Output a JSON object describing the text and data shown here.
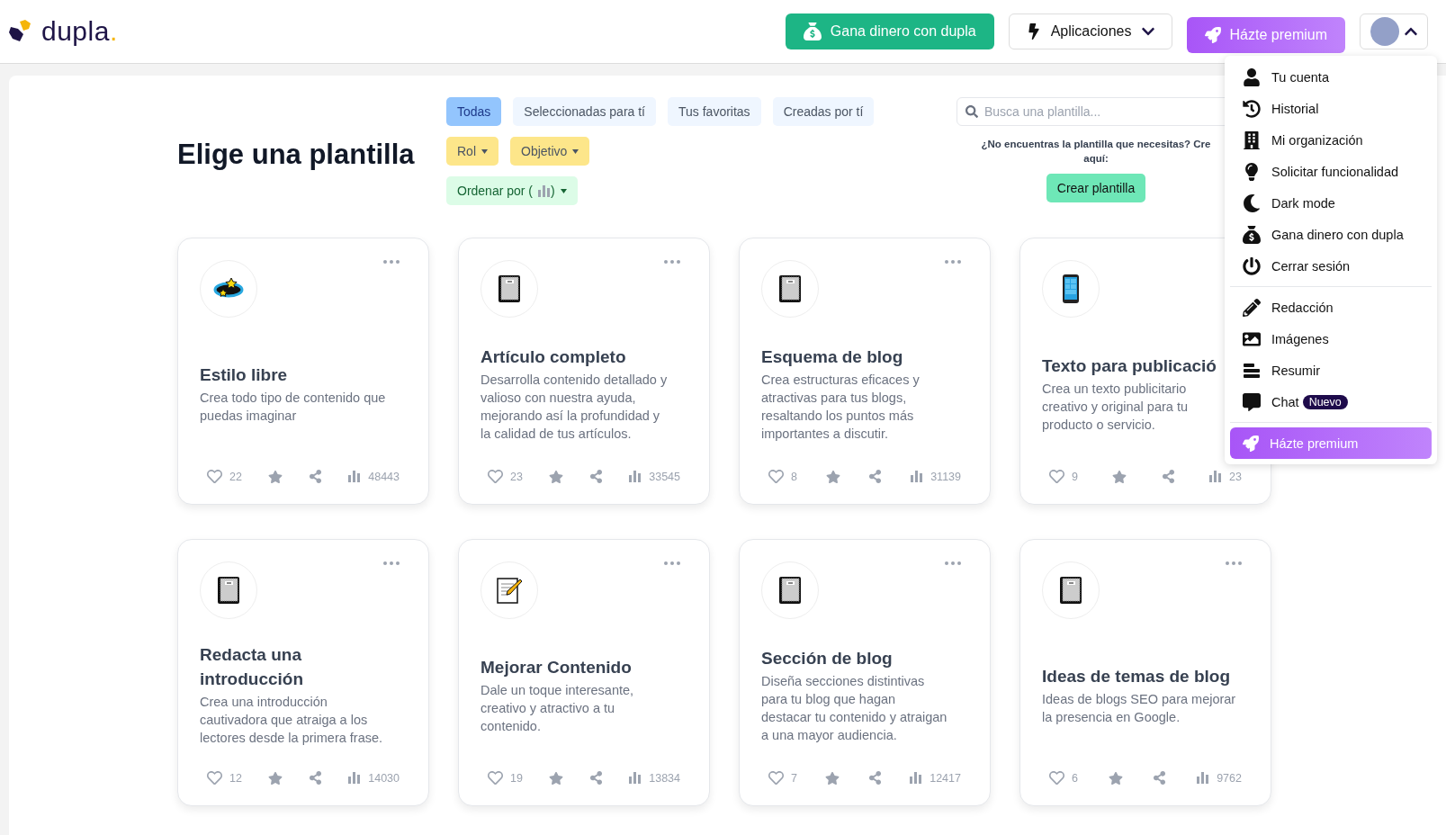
{
  "header": {
    "logo": {
      "name": "dupla",
      "dot": "."
    },
    "buttons": [
      {
        "kind": "earn",
        "label": "Gana dinero con dupla"
      },
      {
        "kind": "apps",
        "label": "Aplicaciones"
      },
      {
        "kind": "premium",
        "label": "Házte premium"
      }
    ],
    "account": {
      "expanded": true
    }
  },
  "title": "Elige una plantilla",
  "tabs": [
    {
      "label": "Todas",
      "selected": true
    },
    {
      "label": "Seleccionadas para tí",
      "selected": false
    },
    {
      "label": "Tus favoritas",
      "selected": false
    },
    {
      "label": "Creadas por tí",
      "selected": false
    }
  ],
  "filters": [
    {
      "label": "Rol"
    },
    {
      "label": "Objetivo"
    }
  ],
  "sort": {
    "label": "Ordenar por (",
    "close": ")"
  },
  "search": {
    "placeholder": "Busca una plantilla..."
  },
  "hint": [
    "¿No encuentras la plantilla que necesitas? Cre",
    "aquí:"
  ],
  "create_button": "Crear plantilla",
  "cards": [
    {
      "kind": "stars",
      "title": "Estilo libre",
      "description": [
        "Crea todo tipo de contenido que",
        "puedas imaginar"
      ],
      "likes": "22",
      "views": "48443",
      "menu": true
    },
    {
      "kind": "notebook",
      "title": "Artículo completo",
      "description": [
        "Desarrolla contenido detallado y",
        "valioso con nuestra ayuda,",
        "mejorando así la profundidad y",
        "la calidad de tus artículos."
      ],
      "likes": "23",
      "views": "33545",
      "menu": true
    },
    {
      "kind": "notebook",
      "title": "Esquema de blog",
      "description": [
        "Crea estructuras eficaces y",
        "atractivas para tus blogs,",
        "resaltando los puntos más",
        "importantes a discutir."
      ],
      "likes": "8",
      "views": "31139",
      "menu": true
    },
    {
      "kind": "phone",
      "title": "Texto para publicació",
      "description": [
        "Crea un texto publicitario",
        "creativo y original para tu",
        "producto o servicio."
      ],
      "likes": "9",
      "views": "23",
      "menu": false
    },
    {
      "kind": "notebook",
      "title": "Redacta una introducción",
      "description": [
        "Crea una introducción",
        "cautivadora que atraiga a los",
        "lectores desde la primera frase."
      ],
      "likes": "12",
      "views": "14030",
      "menu": true
    },
    {
      "kind": "memo",
      "title": "Mejorar Contenido",
      "description": [
        "Dale un toque interesante,",
        "creativo y atractivo a tu",
        "contenido."
      ],
      "likes": "19",
      "views": "13834",
      "menu": true
    },
    {
      "kind": "notebook",
      "title": "Sección de blog",
      "description": [
        "Diseña secciones distintivas",
        "para tu blog que hagan",
        "destacar tu contenido y atraigan",
        "a una mayor audiencia."
      ],
      "likes": "7",
      "views": "12417",
      "menu": true
    },
    {
      "kind": "notebook",
      "title": "Ideas de temas de blog",
      "description": [
        "Ideas de blogs SEO para mejorar",
        "la presencia en Google."
      ],
      "likes": "6",
      "views": "9762",
      "menu": true
    }
  ],
  "menu": {
    "groups": [
      [
        {
          "kind": "user",
          "label": "Tu cuenta"
        },
        {
          "kind": "history",
          "label": "Historial"
        },
        {
          "kind": "building",
          "label": "Mi organización"
        },
        {
          "kind": "bulb",
          "label": "Solicitar funcionalidad"
        },
        {
          "kind": "moon",
          "label": "Dark mode"
        },
        {
          "kind": "money",
          "label": "Gana dinero con dupla"
        },
        {
          "kind": "power",
          "label": "Cerrar sesión"
        }
      ],
      [
        {
          "kind": "pencil",
          "label": "Redacción"
        },
        {
          "kind": "image",
          "label": "Imágenes"
        },
        {
          "kind": "summary",
          "label": "Resumir"
        },
        {
          "kind": "chat",
          "label": "Chat",
          "badge": "Nuevo"
        }
      ]
    ],
    "premium": "Házte premium"
  }
}
